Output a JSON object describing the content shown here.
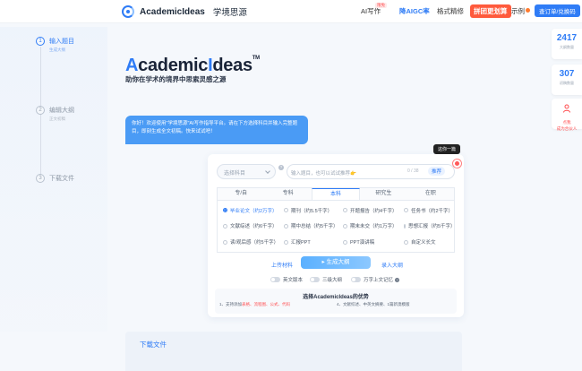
{
  "header": {
    "logo_text": "AcademicIdeas",
    "logo_cn": "学境思源",
    "nav": {
      "ai_writing": "AI写作",
      "ai_badge": "限免",
      "reduce_aigc": "降AIGC率",
      "format": "格式精修",
      "group_buy": "拼团更划算",
      "example": "示例",
      "orders": "查订单/兑换码"
    }
  },
  "steps": [
    {
      "num": "1",
      "title": "输入题目",
      "sub": "生成大纲"
    },
    {
      "num": "2",
      "title": "编辑大纲",
      "sub": "正文初稿"
    },
    {
      "num": "3",
      "title": "下载文件",
      "sub": ""
    }
  ],
  "hero": {
    "title_a": "A",
    "title_mid": "cademic",
    "title_b": "I",
    "title_end": "deas",
    "tm": "TM",
    "subtitle": "助你在学术的境界中思索灵感之源"
  },
  "bubble": "你好！欢迎使用\"学境思源\"AI写作指导平台。请在下方选择科目并输入完整题目，即刻生成全文初稿。快来试试吧！",
  "stats": [
    {
      "num": "2417",
      "label": "大纲数量"
    },
    {
      "num": "307",
      "label": "初稿数量"
    }
  ],
  "invite": {
    "line1": "点我",
    "line2": "成为合伙人"
  },
  "tooltip": "这你一篇",
  "subject_select": {
    "placeholder": "选择科目"
  },
  "topic_input": {
    "placeholder": "输入题目，也可以试试推荐👉",
    "count": "0 / 38",
    "recommend": "推荐"
  },
  "tabs": [
    "专/自",
    "专科",
    "本科",
    "研究生",
    "在职"
  ],
  "active_tab": 2,
  "options": [
    {
      "label": "毕业论文（约2万字）",
      "selected": true
    },
    {
      "label": "期刊（约5.5千字）",
      "selected": false
    },
    {
      "label": "开题报告（约4千字）",
      "selected": false
    },
    {
      "label": "任务书（约2千字）",
      "selected": false
    },
    {
      "label": "文献综述（约6千字）",
      "selected": false
    },
    {
      "label": "期中总结（约5千字）",
      "selected": false
    },
    {
      "label": "期末未交（约1万字）",
      "selected": false
    },
    {
      "label": "思想汇报（约5千字）",
      "selected": false
    },
    {
      "label": "读/观后感（约5千字）",
      "selected": false
    },
    {
      "label": "汇报PPT",
      "selected": false
    },
    {
      "label": "PPT演讲稿",
      "selected": false
    },
    {
      "label": "自定义长文",
      "selected": false
    }
  ],
  "actions": {
    "upload": "上传材料",
    "generate": "生成大纲",
    "reference": "录入大纲"
  },
  "toggles": [
    "英文版本",
    "三级大纲",
    "万字上文记忆"
  ],
  "advantages": {
    "title": "选择AcademicIdeas的优势",
    "left_prefix": "1、支持添加",
    "left_red": "表格、流程图、公式、代码",
    "right": "4、文献综述、中英文摘要、1篇新澳模版"
  },
  "download": {
    "title": "下载文件"
  },
  "colors": {
    "primary": "#2f7cf6",
    "accent": "#ff5a3c"
  }
}
